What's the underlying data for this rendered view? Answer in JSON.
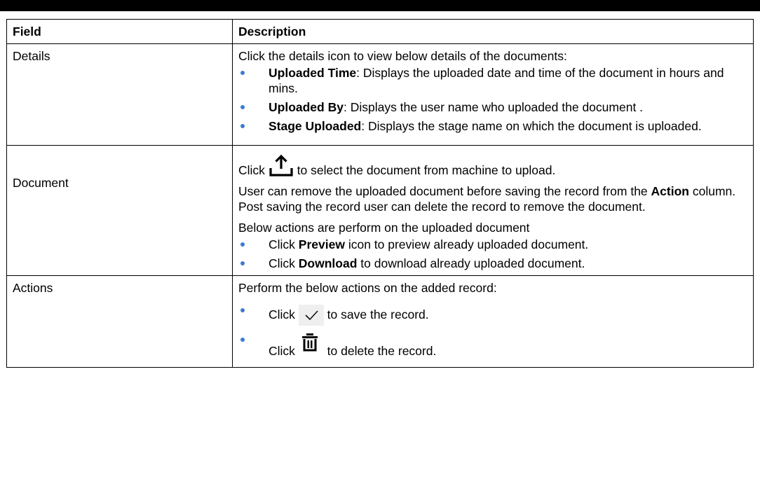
{
  "table": {
    "headers": {
      "field": "Field",
      "description": "Description"
    },
    "details": {
      "field": "Details",
      "intro": "Click the details icon to view below details of the documents:",
      "items": [
        {
          "term": "Uploaded Time",
          "text": ": Displays the uploaded date and time of the document in hours and mins."
        },
        {
          "term": "Uploaded By",
          "text": ": Displays the user name who uploaded the document ."
        },
        {
          "term": "Stage Uploaded",
          "text": ": Displays the stage name on which the document is uploaded."
        }
      ]
    },
    "document": {
      "field": "Document",
      "click_pre": "Click",
      "click_post": "to select the document from machine to upload.",
      "para2_pre": "User can remove the uploaded document before saving the record from the",
      "para2_bold": "Action",
      "para2_post": "column. Post saving the record user can delete the record to remove the document.",
      "para3": "Below actions are perform on the uploaded document",
      "items": [
        {
          "pre": "Click",
          "bold": "Preview",
          "post": "icon to preview already uploaded document."
        },
        {
          "pre": "Click",
          "bold": "Download",
          "post": "to download already uploaded document."
        }
      ]
    },
    "actions": {
      "field": "Actions",
      "intro": "Perform the below actions on the added record:",
      "items": [
        {
          "pre": "Click",
          "post": "to save the record.",
          "icon": "check-icon"
        },
        {
          "pre": "Click",
          "post": "to delete the record.",
          "icon": "trash-icon"
        }
      ]
    }
  }
}
